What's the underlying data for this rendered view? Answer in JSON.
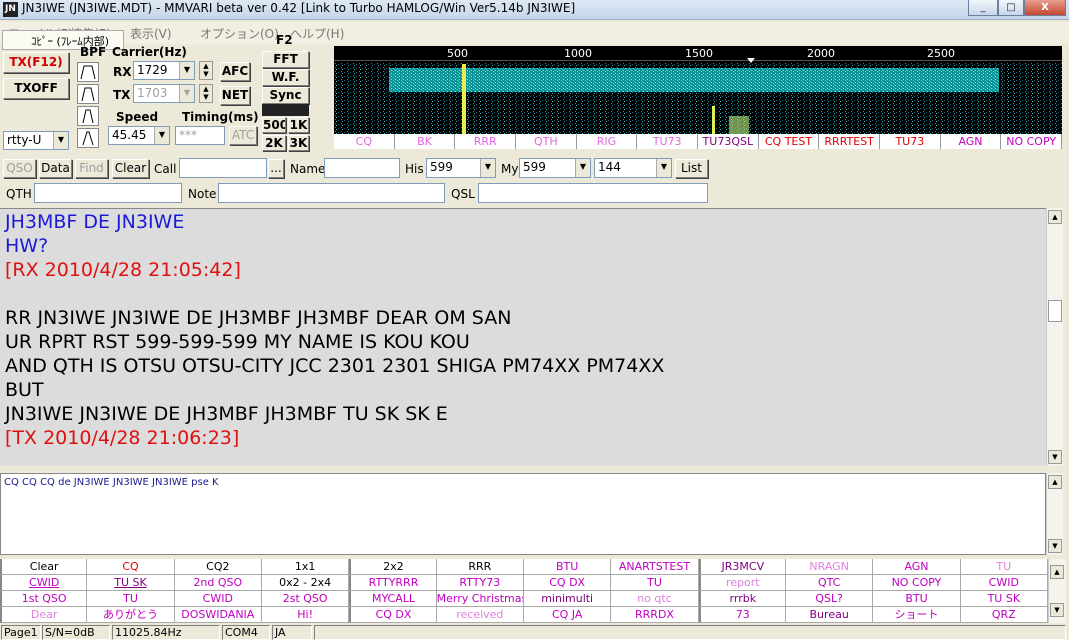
{
  "window": {
    "title": "JN3IWE (JN3IWE.MDT) - MMVARI beta ver 0.42 [Link to Turbo HAMLOG/Win Ver5.14b JN3IWE]",
    "icon_text": "JN",
    "minimize": "_",
    "maximize": "□",
    "close": "X"
  },
  "menu": {
    "popup_label": "ｺﾋﾟｰ (ﾌﾚｰﾑ内部)",
    "f2": "F2",
    "items": [
      "ファイル(F)",
      "編集(E)",
      "表示(V)",
      "オプション(O)",
      "ヘルプ(H)"
    ]
  },
  "controls": {
    "txf12": "TX(F12)",
    "txoff": "TXOFF",
    "bpf_label": "BPF",
    "carrier_label": "Carrier(Hz)",
    "rx_label": "RX",
    "rx_value": "1729",
    "tx_label": "TX",
    "tx_value": "1703",
    "afc": "AFC",
    "net": "NET",
    "fft": "FFT",
    "wf": "W.F.",
    "sync": "Sync",
    "mode_value": "rtty-U",
    "speed_label": "Speed",
    "speed_value": "45.45",
    "timing_label": "Timing(ms)",
    "timing_value": "***",
    "atc": "ATC",
    "b500": "500",
    "b1k": "1K",
    "b2k": "2K",
    "b3k": "3K"
  },
  "waterfall": {
    "ticks": [
      "500",
      "1000",
      "1500",
      "2000",
      "2500"
    ],
    "macros": [
      {
        "label": "CQ",
        "color": "#e066e0"
      },
      {
        "label": "BK",
        "color": "#e066e0"
      },
      {
        "label": "RRR",
        "color": "#e066e0"
      },
      {
        "label": "QTH",
        "color": "#e066e0"
      },
      {
        "label": "RIG",
        "color": "#e066e0"
      },
      {
        "label": "TU73",
        "color": "#e066e0"
      },
      {
        "label": "TU73QSL",
        "color": "#800080"
      },
      {
        "label": "CQ TEST",
        "color": "#e00000"
      },
      {
        "label": "RRRTEST",
        "color": "#e00000"
      },
      {
        "label": "TU73",
        "color": "#e00000"
      },
      {
        "label": "AGN",
        "color": "#c000c0"
      },
      {
        "label": "NO COPY",
        "color": "#c000c0"
      }
    ]
  },
  "logbar": {
    "qso": "QSO",
    "data": "Data",
    "find": "Find",
    "clear": "Clear",
    "call_label": "Call",
    "call_value": "",
    "dots": "...",
    "name_label": "Name",
    "name_value": "",
    "his_label": "His",
    "his_value": "599",
    "my_label": "My",
    "my_value": "599",
    "band_value": "144",
    "list": "List",
    "qth_label": "QTH",
    "note_label": "Note",
    "qsl_label": "QSL"
  },
  "rx_text": [
    {
      "text": "JH3MBF DE JN3IWE",
      "color": "#1a1ad8"
    },
    {
      "text": "HW?",
      "color": "#1a1ad8"
    },
    {
      "text": "[RX 2010/4/28 21:05:42]",
      "color": "#e01010"
    },
    {
      "text": "",
      "color": "#000000"
    },
    {
      "text": "RR  JN3IWE JN3IWE DE JH3MBF JH3MBF DEAR OM  SAN",
      "color": "#000000"
    },
    {
      "text": "UR RPRT RST 599-599-599 MY NAME  IS KOU KOU",
      "color": "#000000"
    },
    {
      "text": "AND QTH IS OTSU OTSU-CITY JCC 2301 2301 SHIGA PM74XX PM74XX",
      "color": "#000000"
    },
    {
      "text": "BUT",
      "color": "#000000"
    },
    {
      "text": "JN3IWE JN3IWE DE JH3MBF JH3MBF  TU SK SK E",
      "color": "#000000"
    },
    {
      "text": "[TX 2010/4/28 21:06:23]",
      "color": "#e01010"
    }
  ],
  "tx_text": "CQ CQ CQ de JN3IWE JN3IWE JN3IWE pse K",
  "macro_grid": [
    [
      {
        "l": "Clear",
        "c": "#000000"
      },
      {
        "l": "CQ",
        "c": "#e00000"
      },
      {
        "l": "CQ2",
        "c": "#000000"
      },
      {
        "l": "1x1",
        "c": "#000000"
      },
      {
        "l": "2x2",
        "c": "#000000"
      },
      {
        "l": "RRR",
        "c": "#000000"
      },
      {
        "l": "BTU",
        "c": "#c000c0"
      },
      {
        "l": "ANARTSTEST",
        "c": "#c000c0"
      },
      {
        "l": "JR3MCV",
        "c": "#800080"
      },
      {
        "l": "NRAGN",
        "c": "#e080e0"
      },
      {
        "l": "AGN",
        "c": "#c000c0"
      },
      {
        "l": "TU",
        "c": "#e080e0"
      }
    ],
    [
      {
        "l": "CWID",
        "c": "#c000c0",
        "u": true
      },
      {
        "l": "TU SK",
        "c": "#800080",
        "u": true
      },
      {
        "l": "2nd QSO",
        "c": "#c000c0"
      },
      {
        "l": "0x2 - 2x4",
        "c": "#000000"
      },
      {
        "l": "RTTYRRR",
        "c": "#c000c0"
      },
      {
        "l": "RTTY73",
        "c": "#c000c0"
      },
      {
        "l": "CQ DX",
        "c": "#c000c0"
      },
      {
        "l": "TU",
        "c": "#c000c0"
      },
      {
        "l": "report",
        "c": "#e080e0"
      },
      {
        "l": "QTC",
        "c": "#c000c0"
      },
      {
        "l": "NO COPY",
        "c": "#c000c0"
      },
      {
        "l": "CWID",
        "c": "#c000c0"
      }
    ],
    [
      {
        "l": "1st QSO",
        "c": "#c000c0"
      },
      {
        "l": "TU",
        "c": "#c000c0"
      },
      {
        "l": "CWID",
        "c": "#c000c0"
      },
      {
        "l": "2st QSO",
        "c": "#c000c0"
      },
      {
        "l": "MYCALL",
        "c": "#c000c0"
      },
      {
        "l": "Merry Christmas",
        "c": "#c000c0"
      },
      {
        "l": "minimulti",
        "c": "#800080"
      },
      {
        "l": "no qtc",
        "c": "#e080e0"
      },
      {
        "l": "rrrbk",
        "c": "#800080"
      },
      {
        "l": "QSL?",
        "c": "#c000c0"
      },
      {
        "l": "BTU",
        "c": "#c000c0"
      },
      {
        "l": "TU SK",
        "c": "#c000c0"
      }
    ],
    [
      {
        "l": "Dear",
        "c": "#e080e0"
      },
      {
        "l": "ありがとう",
        "c": "#c000c0"
      },
      {
        "l": "DOSWIDANIA",
        "c": "#c000c0"
      },
      {
        "l": "Hi!",
        "c": "#c000c0"
      },
      {
        "l": "CQ DX",
        "c": "#c000c0"
      },
      {
        "l": "received",
        "c": "#e080e0"
      },
      {
        "l": "CQ JA",
        "c": "#c000c0"
      },
      {
        "l": "RRRDX",
        "c": "#c000c0"
      },
      {
        "l": "73",
        "c": "#c000c0"
      },
      {
        "l": "Bureau",
        "c": "#800080"
      },
      {
        "l": "ショート",
        "c": "#c000c0"
      },
      {
        "l": "QRZ",
        "c": "#c000c0"
      }
    ]
  ],
  "statusbar": {
    "page": "Page1",
    "sn": "S/N=0dB",
    "freq": "11025.84Hz",
    "port": "COM4",
    "lang": "JA"
  }
}
